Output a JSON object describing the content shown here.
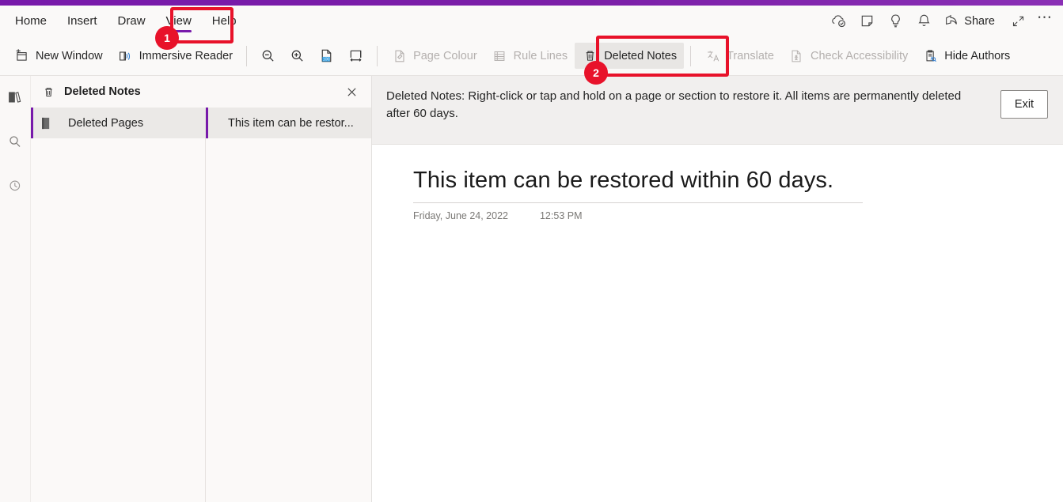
{
  "window": {
    "accent_color": "#7719aa",
    "annotation_color": "#e8122a"
  },
  "ribbon": {
    "tabs": [
      {
        "label": "Home",
        "active": false
      },
      {
        "label": "Insert",
        "active": false
      },
      {
        "label": "Draw",
        "active": false
      },
      {
        "label": "View",
        "active": true
      },
      {
        "label": "Help",
        "active": false
      }
    ],
    "quick_access": [
      {
        "name": "sync-cloud-icon",
        "label": "Sync"
      },
      {
        "name": "sticky-note-icon",
        "label": "Sticky Notes"
      },
      {
        "name": "lightbulb-icon",
        "label": "Tell me what you want to do"
      },
      {
        "name": "bell-icon",
        "label": "Notifications"
      }
    ],
    "share_label": "Share",
    "expand_label": "Full screen",
    "more_label": "More options",
    "commands": [
      {
        "label": "New Window",
        "icon": "new-window-icon",
        "disabled": false,
        "active": false
      },
      {
        "label": "Immersive Reader",
        "icon": "immersive-reader-icon",
        "disabled": false,
        "active": false
      },
      {
        "label": "",
        "icon": "zoom-out-icon",
        "disabled": false,
        "active": false
      },
      {
        "label": "",
        "icon": "zoom-in-icon",
        "disabled": false,
        "active": false
      },
      {
        "label": "",
        "icon": "zoom-100-icon",
        "disabled": false,
        "active": false
      },
      {
        "label": "",
        "icon": "page-width-icon",
        "disabled": false,
        "active": false
      },
      {
        "label": "Page Colour",
        "icon": "page-colour-icon",
        "disabled": true,
        "active": false
      },
      {
        "label": "Rule Lines",
        "icon": "rule-lines-icon",
        "disabled": true,
        "active": false
      },
      {
        "label": "Deleted Notes",
        "icon": "trash-icon",
        "disabled": false,
        "active": true
      },
      {
        "label": "Translate",
        "icon": "translate-icon",
        "disabled": true,
        "active": false
      },
      {
        "label": "Check Accessibility",
        "icon": "check-accessibility-icon",
        "disabled": true,
        "active": false
      },
      {
        "label": "Hide Authors",
        "icon": "hide-authors-icon",
        "disabled": false,
        "active": false
      }
    ]
  },
  "rail": {
    "items": [
      {
        "name": "notebooks-icon",
        "label": "Notebooks"
      },
      {
        "name": "search-icon",
        "label": "Search"
      },
      {
        "name": "recent-notes-icon",
        "label": "Recent Notes"
      }
    ]
  },
  "deleted_notes_panel": {
    "header_title": "Deleted Notes",
    "close_label": "Close",
    "sections": [
      {
        "label": "Deleted Pages",
        "selected": true
      }
    ],
    "pages": [
      {
        "label": "This item can be restor...",
        "selected": true
      }
    ]
  },
  "info_bar": {
    "message": "Deleted Notes: Right-click or tap and hold on a page or section to restore it. All items are permanently deleted after 60 days.",
    "exit_label": "Exit"
  },
  "page": {
    "title": "This item can be restored within 60 days.",
    "date": "Friday, June 24, 2022",
    "time": "12:53 PM"
  },
  "annotations": [
    {
      "badge": "1",
      "target": "view-tab"
    },
    {
      "badge": "2",
      "target": "deleted-notes-button"
    }
  ]
}
